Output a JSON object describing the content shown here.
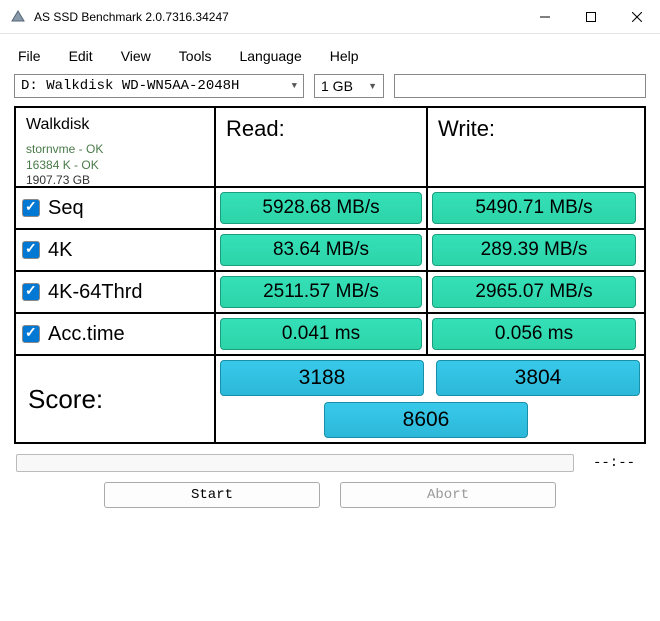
{
  "window": {
    "title": "AS SSD Benchmark 2.0.7316.34247"
  },
  "menu": {
    "file": "File",
    "edit": "Edit",
    "view": "View",
    "tools": "Tools",
    "language": "Language",
    "help": "Help"
  },
  "toolbar": {
    "drive": "D: Walkdisk WD-WN5AA-2048H",
    "size": "1 GB"
  },
  "info": {
    "name": "Walkdisk",
    "driver": "stornvme - OK",
    "align": "16384 K - OK",
    "capacity": "1907.73 GB"
  },
  "headers": {
    "read": "Read:",
    "write": "Write:"
  },
  "tests": {
    "seq": {
      "label": "Seq",
      "read": "5928.68 MB/s",
      "write": "5490.71 MB/s"
    },
    "4k": {
      "label": "4K",
      "read": "83.64 MB/s",
      "write": "289.39 MB/s"
    },
    "4k64": {
      "label": "4K-64Thrd",
      "read": "2511.57 MB/s",
      "write": "2965.07 MB/s"
    },
    "acc": {
      "label": "Acc.time",
      "read": "0.041 ms",
      "write": "0.056 ms"
    }
  },
  "score": {
    "label": "Score:",
    "read": "3188",
    "write": "3804",
    "total": "8606"
  },
  "progress": {
    "time": "--:--"
  },
  "buttons": {
    "start": "Start",
    "abort": "Abort"
  }
}
